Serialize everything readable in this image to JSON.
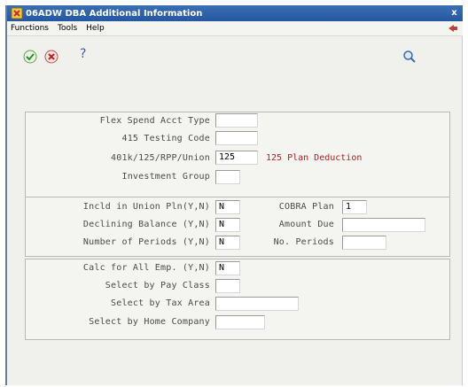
{
  "window": {
    "title": "06ADW  DBA Additional Information",
    "close_glyph": "x"
  },
  "menubar": {
    "functions": "Functions",
    "tools": "Tools",
    "help": "Help"
  },
  "toolbar": {
    "ok_icon": "checkmark-icon",
    "cancel_icon": "cancel-icon",
    "help_glyph": "?",
    "search_icon": "magnifier-icon"
  },
  "section1": {
    "flex_spend_label": "Flex Spend Acct Type",
    "flex_spend_value": "",
    "testing_code_label": "415 Testing Code",
    "testing_code_value": "",
    "plan_label": "401k/125/RPP/Union",
    "plan_value": "125",
    "plan_description": "125 Plan Deduction",
    "investment_group_label": "Investment Group",
    "investment_group_value": ""
  },
  "section2": {
    "incld_union_label": "Incld in Union Pln(Y,N)",
    "incld_union_value": "N",
    "declining_balance_label": "Declining Balance (Y,N)",
    "declining_balance_value": "N",
    "number_periods_label": "Number of Periods (Y,N)",
    "number_periods_value": "N",
    "cobra_plan_label": "COBRA Plan",
    "cobra_plan_value": "1",
    "amount_due_label": "Amount Due",
    "amount_due_value": "",
    "no_periods_label": "No. Periods",
    "no_periods_value": ""
  },
  "section3": {
    "calc_all_label": "Calc for All Emp. (Y,N)",
    "calc_all_value": "N",
    "pay_class_label": "Select by Pay Class",
    "pay_class_value": "",
    "tax_area_label": "Select by Tax Area",
    "tax_area_value": "",
    "home_company_label": "Select by Home Company",
    "home_company_value": ""
  },
  "colors": {
    "title_bar": "#2457a0",
    "description_text": "#b02020",
    "label_text": "#4a4a4a"
  }
}
